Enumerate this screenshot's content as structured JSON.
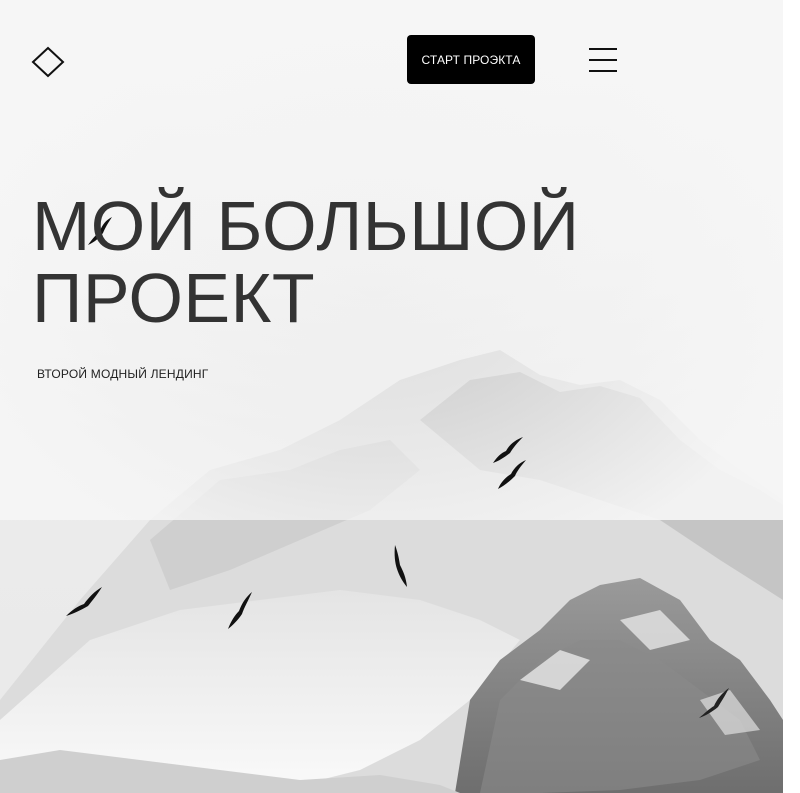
{
  "header": {
    "logo_icon": "diamond-outline-icon",
    "cta_label": "СТАРТ ПРОЭКТА",
    "menu_icon": "hamburger-menu-icon"
  },
  "hero": {
    "title_line1": "МОЙ БОЛЬШОЙ",
    "title_line2": "ПРОЕКТ",
    "subtitle": "ВТОРОЙ МОДНЫЙ ЛЕНДИНГ",
    "background": "snowy-mountain-with-birds-photo"
  },
  "colors": {
    "button_bg": "#000000",
    "button_text": "#ffffff",
    "title_text": "#333333",
    "sky": "#f3f3f3"
  }
}
